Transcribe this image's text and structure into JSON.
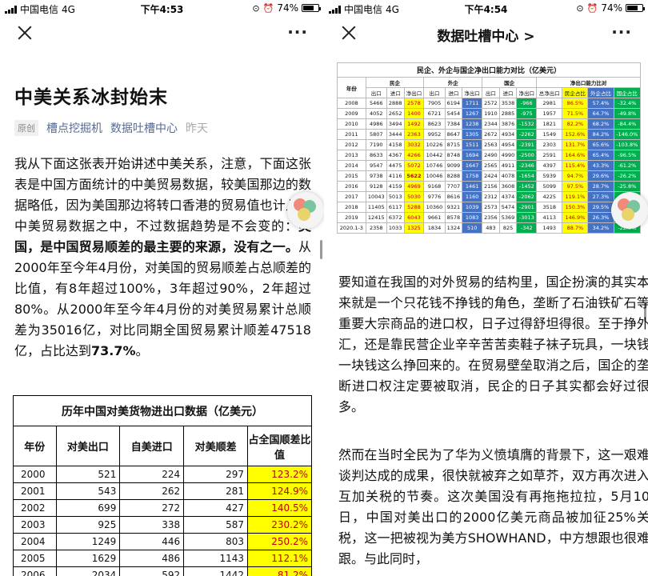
{
  "left": {
    "status": {
      "carrier": "中国电信",
      "network": "4G",
      "time": "下午4:53",
      "battery": "74%",
      "battery_level": 0.74
    },
    "title": "中美关系冰封始末",
    "meta": {
      "badge": "原创",
      "author": "槽点挖掘机",
      "account": "数据吐槽中心",
      "date": "昨天"
    },
    "para": [
      "我从下面这张表开始讲述中美关系，注意，下面这张表是中国方面统计的中美贸易数据，较美国那边的数据略低，因为美国那边将转口香港的贸易值也计入了中美贸易数据之中，不过数据趋势是不会变的：",
      "美国，是中国贸易顺差的最主要的来源，没有之一。",
      "从2000年至今年4月份，对美国的贸易顺差占总顺差的比值，有8年超过100%，3年超过90%，2年超过80%。从2000年至今年4月份的对美贸易累计总顺差为35016亿，对比同期全国贸易累计顺差47518亿，占比达到",
      "73.7%",
      "。"
    ],
    "table": {
      "caption": "历年中国对美货物进出口数据（亿美元）",
      "headers": [
        "年份",
        "对美出口",
        "自美进口",
        "对美顺差",
        "占全国顺差比值"
      ],
      "rows": [
        [
          "2000",
          "521",
          "224",
          "297",
          "123.2%"
        ],
        [
          "2001",
          "543",
          "262",
          "281",
          "124.9%"
        ],
        [
          "2002",
          "699",
          "272",
          "427",
          "140.5%"
        ],
        [
          "2003",
          "925",
          "338",
          "587",
          "230.2%"
        ],
        [
          "2004",
          "1249",
          "446",
          "803",
          "250.2%"
        ],
        [
          "2005",
          "1629",
          "486",
          "1143",
          "112.1%"
        ],
        [
          "2006",
          "2034",
          "592",
          "1442",
          "81.2%"
        ]
      ]
    }
  },
  "right": {
    "status": {
      "carrier": "中国电信",
      "network": "4G",
      "time": "下午4:54",
      "battery": "74%",
      "battery_level": 0.74
    },
    "nav_title": "数据吐槽中心 >",
    "table": {
      "caption": "民企、外企与国企净出口能力对比（亿美元）",
      "group_headers": [
        "年份",
        "民企",
        "外企",
        "国企",
        "净出口能力比对"
      ],
      "sub_headers": [
        "出口",
        "进口",
        "净出口",
        "出口",
        "进口",
        "净出口",
        "出口",
        "进口",
        "净出口",
        "总净出口",
        "民企占比",
        "外企占比",
        "国企占比"
      ],
      "rows": [
        [
          "2008",
          "5466",
          "2888",
          "2578",
          "7905",
          "6194",
          "1711",
          "2572",
          "3538",
          "-966",
          "2981",
          "86.5%",
          "57.4%",
          "-32.4%"
        ],
        [
          "2009",
          "4052",
          "2652",
          "1400",
          "6721",
          "5454",
          "1267",
          "1910",
          "2885",
          "-975",
          "1957",
          "71.5%",
          "64.7%",
          "-49.8%"
        ],
        [
          "2010",
          "4986",
          "3494",
          "1492",
          "8623",
          "7384",
          "1238",
          "2344",
          "3876",
          "-1532",
          "1821",
          "82.2%",
          "68.2%",
          "-84.4%"
        ],
        [
          "2011",
          "5807",
          "3444",
          "2363",
          "9952",
          "8647",
          "1305",
          "2672",
          "4934",
          "-2262",
          "1549",
          "152.6%",
          "84.2%",
          "-146.0%"
        ],
        [
          "2012",
          "7190",
          "4158",
          "3032",
          "10226",
          "8715",
          "1511",
          "2563",
          "4954",
          "-2391",
          "2303",
          "131.7%",
          "65.6%",
          "-103.8%"
        ],
        [
          "2013",
          "8633",
          "4367",
          "4266",
          "10442",
          "8748",
          "1694",
          "2490",
          "4990",
          "-2500",
          "2591",
          "164.6%",
          "65.4%",
          "-96.5%"
        ],
        [
          "2014",
          "9547",
          "4475",
          "5072",
          "10746",
          "9099",
          "1647",
          "2565",
          "4911",
          "-2346",
          "4397",
          "115.4%",
          "43.3%",
          "-61.2%"
        ],
        [
          "2015",
          "9738",
          "4116",
          "5622",
          "10046",
          "8288",
          "1758",
          "2424",
          "4078",
          "-1654",
          "5939",
          "94.7%",
          "29.6%",
          "-26.2%"
        ],
        [
          "2016",
          "9128",
          "4159",
          "4969",
          "9168",
          "7707",
          "1461",
          "2156",
          "3608",
          "-1452",
          "5099",
          "97.5%",
          "28.7%",
          "-25.8%"
        ],
        [
          "2017",
          "10043",
          "5013",
          "5030",
          "9776",
          "8616",
          "1160",
          "2312",
          "4374",
          "-2062",
          "4225",
          "119.1%",
          "27.3%",
          "-46.4%"
        ],
        [
          "2018",
          "11405",
          "6117",
          "5288",
          "10360",
          "9321",
          "1039",
          "2573",
          "5474",
          "-2901",
          "3518",
          "150.3%",
          "29.5%",
          "-78.8%"
        ],
        [
          "2019",
          "12415",
          "6372",
          "6043",
          "9661",
          "8578",
          "1083",
          "2356",
          "5369",
          "-3013",
          "4113",
          "146.9%",
          "26.3%",
          "-73.2%"
        ],
        [
          "2020.1-3",
          "2358",
          "1033",
          "1325",
          "1834",
          "1324",
          "510",
          "483",
          "825",
          "-342",
          "1493",
          "88.7%",
          "34.2%",
          "-22.9%"
        ]
      ]
    },
    "para1": "要知道在我国的对外贸易的结构里，国企扮演的其实本来就是一个只花钱不挣钱的角色，垄断了石油铁矿石等重要大宗商品的进口权，日子过得舒坦得很。至于挣外汇，还是靠民营企业辛辛苦苦卖鞋子袜子玩具，一块钱一块钱这么挣回来的。在贸易壁垒取消之后，国企的垄断进口权注定要被取消，民企的日子其实都会好过很多。",
    "para2": "然而在当时全民为了华为义愤填膺的背景下，这一艰难谈判达成的成果，很快就被弃之如草芥，双方再次进入互加关税的节奏。这次美国没有再拖拖拉拉，5月10日，中国对美出口的2000亿美元商品被加征25%关税，这一把被视为美方SHOWHAND，中方想跟也很难跟。与此同时，"
  },
  "colors": {
    "link": "#576b95",
    "highlight_yellow": "#ffff00",
    "value_red": "#c00000",
    "col_blue": "#4472c4",
    "col_green": "#00b050"
  }
}
